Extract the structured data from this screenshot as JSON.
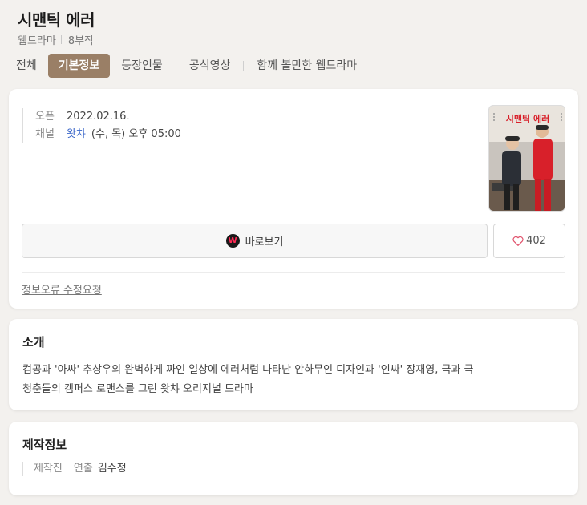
{
  "title": "시맨틱 에러",
  "meta": {
    "genre": "웹드라마",
    "episodes": "8부작"
  },
  "tabs": [
    {
      "label": "전체",
      "active": false
    },
    {
      "label": "기본정보",
      "active": true
    },
    {
      "label": "등장인물",
      "active": false
    },
    {
      "label": "공식영상",
      "active": false
    },
    {
      "label": "함께 볼만한 웹드라마",
      "active": false
    }
  ],
  "basic": {
    "open_label": "오픈",
    "open_value": "2022.02.16.",
    "channel_label": "채널",
    "channel_value": "왓챠",
    "channel_schedule": "(수, 목) 오후 05:00",
    "watch_button": "바로보기",
    "watch_logo": "W",
    "like_count": "402",
    "report_link": "정보오류 수정요청",
    "poster_title": "시맨틱 에러"
  },
  "intro": {
    "heading": "소개",
    "line1": "컴공과 '아싸' 추상우의 완벽하게 짜인 일상에 에러처럼 나타난 안하무인 디자인과 '인싸' 장재영, 극과 극",
    "line2": "청춘들의 캠퍼스 로맨스를 그린 왓챠 오리지널 드라마"
  },
  "production": {
    "heading": "제작정보",
    "crew_label": "제작진",
    "role_label": "연출",
    "name": "김수정"
  },
  "colors": {
    "active_tab": "#9a7f66",
    "link": "#3a66c9",
    "poster_red": "#d8202a"
  }
}
